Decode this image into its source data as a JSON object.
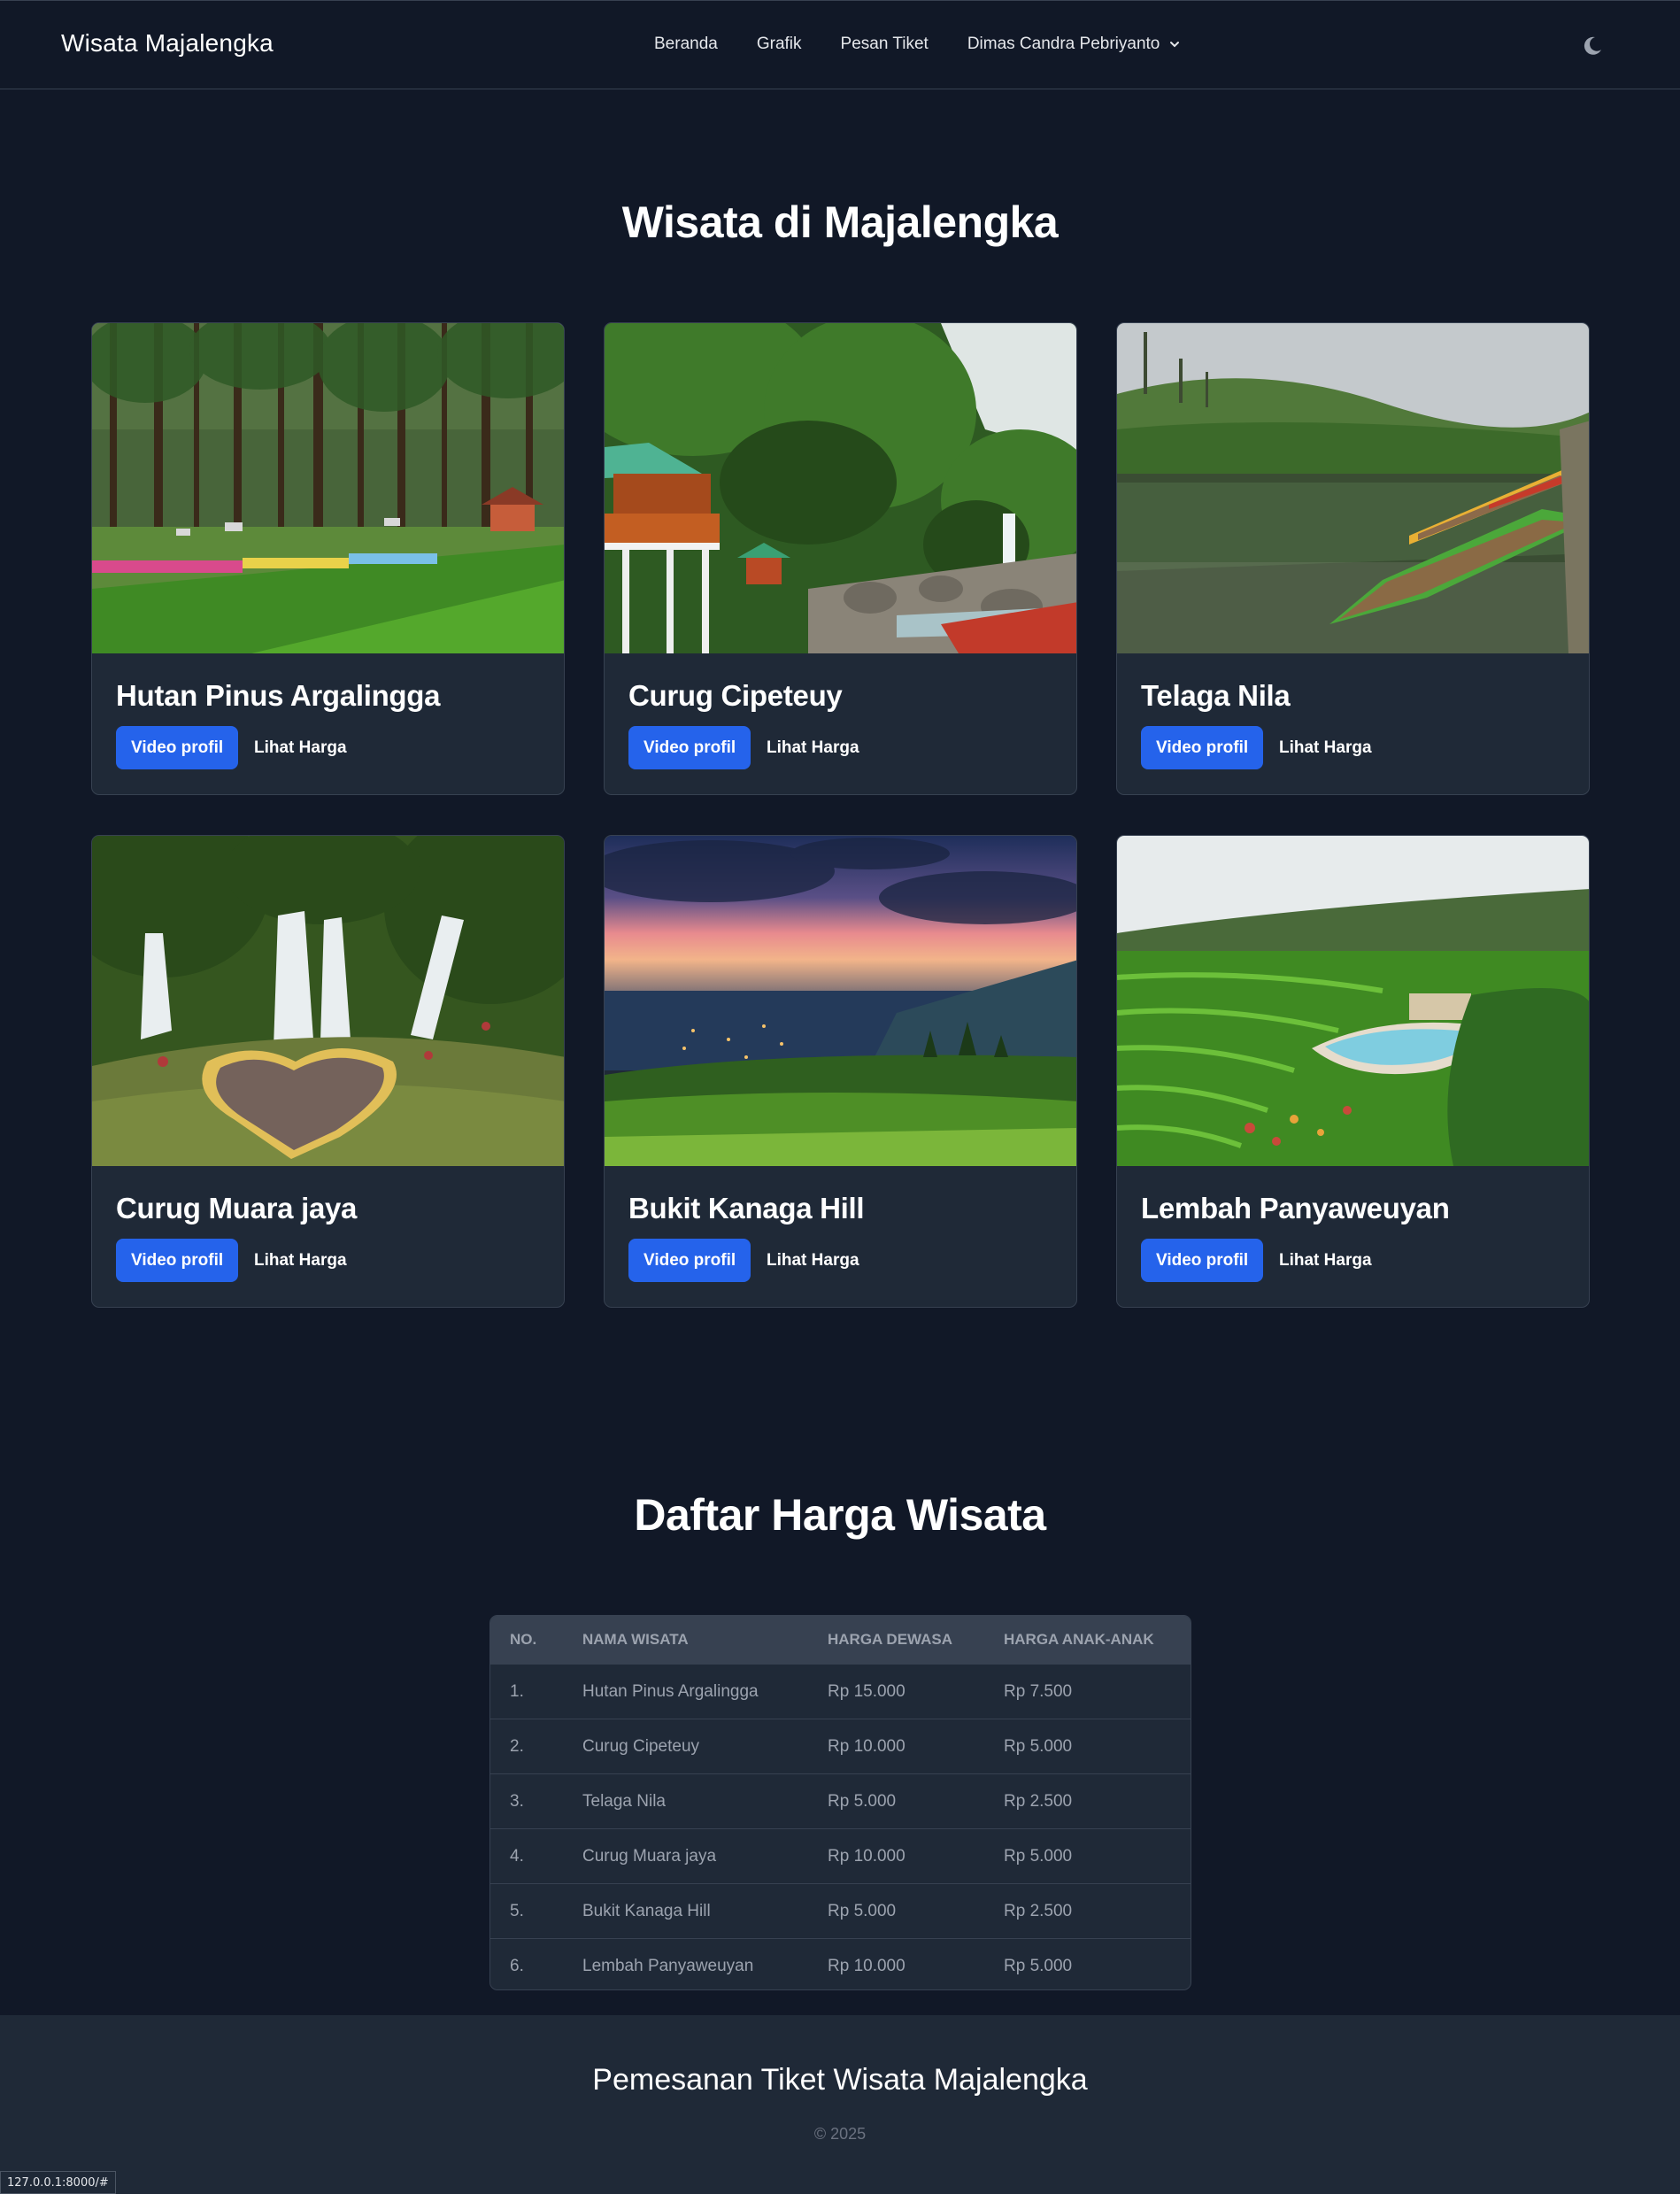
{
  "navbar": {
    "brand": "Wisata Majalengka",
    "links": [
      "Beranda",
      "Grafik",
      "Pesan Tiket"
    ],
    "user_name": "Dimas Candra Pebriyanto",
    "theme_toggle_icon": "moon-icon"
  },
  "attractions_section": {
    "title": "Wisata di Majalengka",
    "video_label": "Video profil",
    "price_label": "Lihat Harga",
    "cards": [
      {
        "name": "Hutan Pinus Argalingga",
        "image": "pine-forest-photo"
      },
      {
        "name": "Curug Cipeteuy",
        "image": "waterfall-cabin-photo"
      },
      {
        "name": "Telaga Nila",
        "image": "lake-boats-photo"
      },
      {
        "name": "Curug Muara jaya",
        "image": "waterfall-heart-photo"
      },
      {
        "name": "Bukit Kanaga Hill",
        "image": "hill-sunset-photo"
      },
      {
        "name": "Lembah Panyaweuyan",
        "image": "rice-terrace-pool-photo"
      }
    ]
  },
  "price_section": {
    "title": "Daftar Harga Wisata",
    "columns": [
      "NO.",
      "NAMA WISATA",
      "HARGA DEWASA",
      "HARGA ANAK-ANAK"
    ],
    "rows": [
      [
        "1.",
        "Hutan Pinus Argalingga",
        "Rp 15.000",
        "Rp 7.500"
      ],
      [
        "2.",
        "Curug Cipeteuy",
        "Rp 10.000",
        "Rp 5.000"
      ],
      [
        "3.",
        "Telaga Nila",
        "Rp 5.000",
        "Rp 2.500"
      ],
      [
        "4.",
        "Curug Muara jaya",
        "Rp 10.000",
        "Rp 5.000"
      ],
      [
        "5.",
        "Bukit Kanaga Hill",
        "Rp 5.000",
        "Rp 2.500"
      ],
      [
        "6.",
        "Lembah Panyaweuyan",
        "Rp 10.000",
        "Rp 5.000"
      ]
    ]
  },
  "footer": {
    "title": "Pemesanan Tiket Wisata Majalengka",
    "copyright": "© 2025"
  },
  "statusbar": {
    "url": "127.0.0.1:8000/#"
  },
  "colors": {
    "background": "#111827",
    "card": "#1f2937",
    "accent": "#2563eb",
    "border": "#374151",
    "muted_text": "#9ca3af"
  }
}
